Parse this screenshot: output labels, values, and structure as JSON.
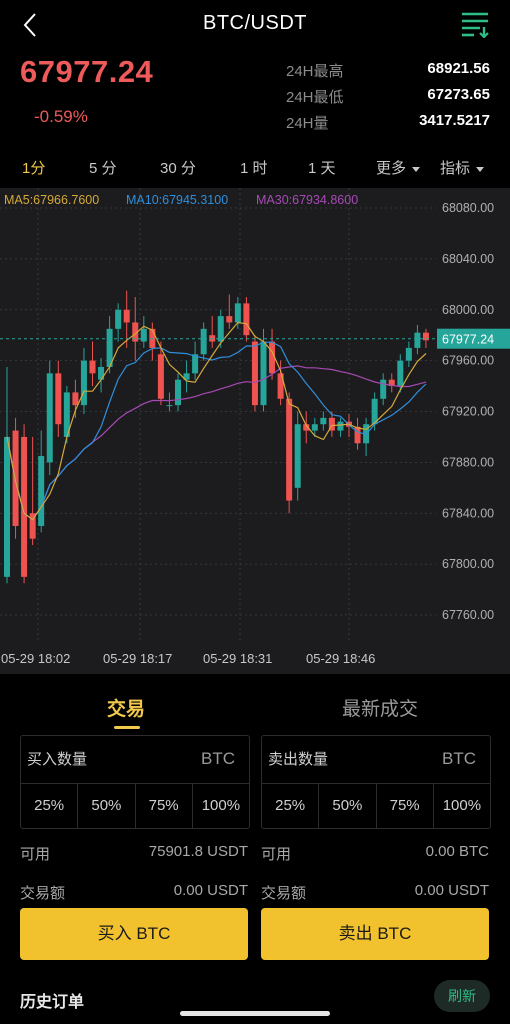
{
  "header": {
    "title": "BTC/USDT",
    "back_icon": "chevron-left-icon",
    "menu_icon": "list-filter-icon",
    "accent": "#2ebd85"
  },
  "ticker": {
    "last_price": "67977.24",
    "change_pct": "-0.59%",
    "stats": [
      {
        "label": "24H最高",
        "value": "68921.56"
      },
      {
        "label": "24H最低",
        "value": "67273.65"
      },
      {
        "label": "24H量",
        "value": "3417.5217"
      }
    ],
    "price_color": "#ef5a5a"
  },
  "intervals": {
    "items": [
      "1分",
      "5 分",
      "30 分",
      "1 时",
      "1 天"
    ],
    "active_index": 0,
    "more_label": "更多",
    "indicator_label": "指标"
  },
  "chart": {
    "ma_labels": {
      "ma5": "MA5:67966.7600",
      "ma10": "MA10:67945.3100",
      "ma30": "MA30:67934.8600"
    },
    "ma_colors": {
      "ma5": "#d4a93a",
      "ma10": "#2f8fdc",
      "ma30": "#a64ab3"
    },
    "price_axis": [
      "68080.00",
      "68040.00",
      "68000.00",
      "67960.00",
      "67920.00",
      "67880.00",
      "67840.00",
      "67800.00",
      "67760.00"
    ],
    "last_price_tag": "67977.24",
    "time_axis": [
      "05-29 18:02",
      "05-29 18:17",
      "05-29 18:31",
      "05-29 18:46"
    ],
    "up_color": "#26a69a",
    "down_color": "#ef5350"
  },
  "chart_data": {
    "type": "candlestick",
    "ylim": [
      67745,
      68090
    ],
    "candles": [
      {
        "o": 67790,
        "h": 67955,
        "c": 67900,
        "l": 67785
      },
      {
        "o": 67905,
        "h": 67915,
        "c": 67830,
        "l": 67820
      },
      {
        "o": 67900,
        "h": 67910,
        "c": 67790,
        "l": 67785
      },
      {
        "o": 67840,
        "h": 67900,
        "c": 67820,
        "l": 67815
      },
      {
        "o": 67830,
        "h": 67905,
        "c": 67885,
        "l": 67825
      },
      {
        "o": 67880,
        "h": 67960,
        "c": 67950,
        "l": 67870
      },
      {
        "o": 67950,
        "h": 67960,
        "c": 67910,
        "l": 67900
      },
      {
        "o": 67900,
        "h": 67940,
        "c": 67935,
        "l": 67895
      },
      {
        "o": 67935,
        "h": 67945,
        "c": 67925,
        "l": 67915
      },
      {
        "o": 67925,
        "h": 67970,
        "c": 67960,
        "l": 67918
      },
      {
        "o": 67960,
        "h": 67975,
        "c": 67950,
        "l": 67940
      },
      {
        "o": 67945,
        "h": 67962,
        "c": 67955,
        "l": 67935
      },
      {
        "o": 67955,
        "h": 67995,
        "c": 67985,
        "l": 67950
      },
      {
        "o": 67985,
        "h": 68005,
        "c": 68000,
        "l": 67975
      },
      {
        "o": 68000,
        "h": 68015,
        "c": 67990,
        "l": 67970
      },
      {
        "o": 67990,
        "h": 68010,
        "c": 67975,
        "l": 67960
      },
      {
        "o": 67975,
        "h": 67995,
        "c": 67985,
        "l": 67970
      },
      {
        "o": 67985,
        "h": 67990,
        "c": 67970,
        "l": 67960
      },
      {
        "o": 67965,
        "h": 67975,
        "c": 67930,
        "l": 67925
      },
      {
        "o": 67925,
        "h": 67935,
        "c": 67925,
        "l": 67920
      },
      {
        "o": 67925,
        "h": 67950,
        "c": 67945,
        "l": 67920
      },
      {
        "o": 67945,
        "h": 67960,
        "c": 67950,
        "l": 67935
      },
      {
        "o": 67950,
        "h": 67975,
        "c": 67965,
        "l": 67945
      },
      {
        "o": 67965,
        "h": 67990,
        "c": 67985,
        "l": 67960
      },
      {
        "o": 67980,
        "h": 67995,
        "c": 67975,
        "l": 67970
      },
      {
        "o": 67975,
        "h": 68000,
        "c": 67995,
        "l": 67970
      },
      {
        "o": 67995,
        "h": 68012,
        "c": 67990,
        "l": 67985
      },
      {
        "o": 67990,
        "h": 68010,
        "c": 68005,
        "l": 67985
      },
      {
        "o": 68005,
        "h": 68010,
        "c": 67980,
        "l": 67975
      },
      {
        "o": 67975,
        "h": 67980,
        "c": 67925,
        "l": 67920
      },
      {
        "o": 67925,
        "h": 67985,
        "c": 67975,
        "l": 67920
      },
      {
        "o": 67975,
        "h": 67985,
        "c": 67950,
        "l": 67945
      },
      {
        "o": 67950,
        "h": 67960,
        "c": 67930,
        "l": 67925
      },
      {
        "o": 67930,
        "h": 67935,
        "c": 67850,
        "l": 67840
      },
      {
        "o": 67860,
        "h": 67920,
        "c": 67910,
        "l": 67850
      },
      {
        "o": 67910,
        "h": 67920,
        "c": 67905,
        "l": 67895
      },
      {
        "o": 67905,
        "h": 67915,
        "c": 67910,
        "l": 67900
      },
      {
        "o": 67910,
        "h": 67920,
        "c": 67915,
        "l": 67905
      },
      {
        "o": 67915,
        "h": 67920,
        "c": 67905,
        "l": 67900
      },
      {
        "o": 67905,
        "h": 67915,
        "c": 67912,
        "l": 67900
      },
      {
        "o": 67912,
        "h": 67918,
        "c": 67908,
        "l": 67900
      },
      {
        "o": 67908,
        "h": 67915,
        "c": 67895,
        "l": 67890
      },
      {
        "o": 67895,
        "h": 67915,
        "c": 67910,
        "l": 67885
      },
      {
        "o": 67910,
        "h": 67935,
        "c": 67930,
        "l": 67905
      },
      {
        "o": 67930,
        "h": 67950,
        "c": 67945,
        "l": 67925
      },
      {
        "o": 67945,
        "h": 67950,
        "c": 67940,
        "l": 67935
      },
      {
        "o": 67940,
        "h": 67965,
        "c": 67960,
        "l": 67935
      },
      {
        "o": 67960,
        "h": 67975,
        "c": 67970,
        "l": 67955
      },
      {
        "o": 67970,
        "h": 67988,
        "c": 67982,
        "l": 67965
      },
      {
        "o": 67982,
        "h": 67985,
        "c": 67976,
        "l": 67970
      }
    ]
  },
  "trade": {
    "tabs": [
      "交易",
      "最新成交"
    ],
    "buy": {
      "qty_label": "买入数量",
      "unit": "BTC",
      "available_label": "可用",
      "available_value": "75901.8 USDT",
      "amount_label": "交易额",
      "amount_value": "0.00 USDT",
      "button": "买入 BTC"
    },
    "sell": {
      "qty_label": "卖出数量",
      "unit": "BTC",
      "available_label": "可用",
      "available_value": "0.00 BTC",
      "amount_label": "交易额",
      "amount_value": "0.00 USDT",
      "button": "卖出 BTC"
    },
    "pcts": [
      "25%",
      "50%",
      "75%",
      "100%"
    ],
    "history_label": "历史订单",
    "refresh_label": "刷新",
    "button_color": "#f2c22e"
  }
}
